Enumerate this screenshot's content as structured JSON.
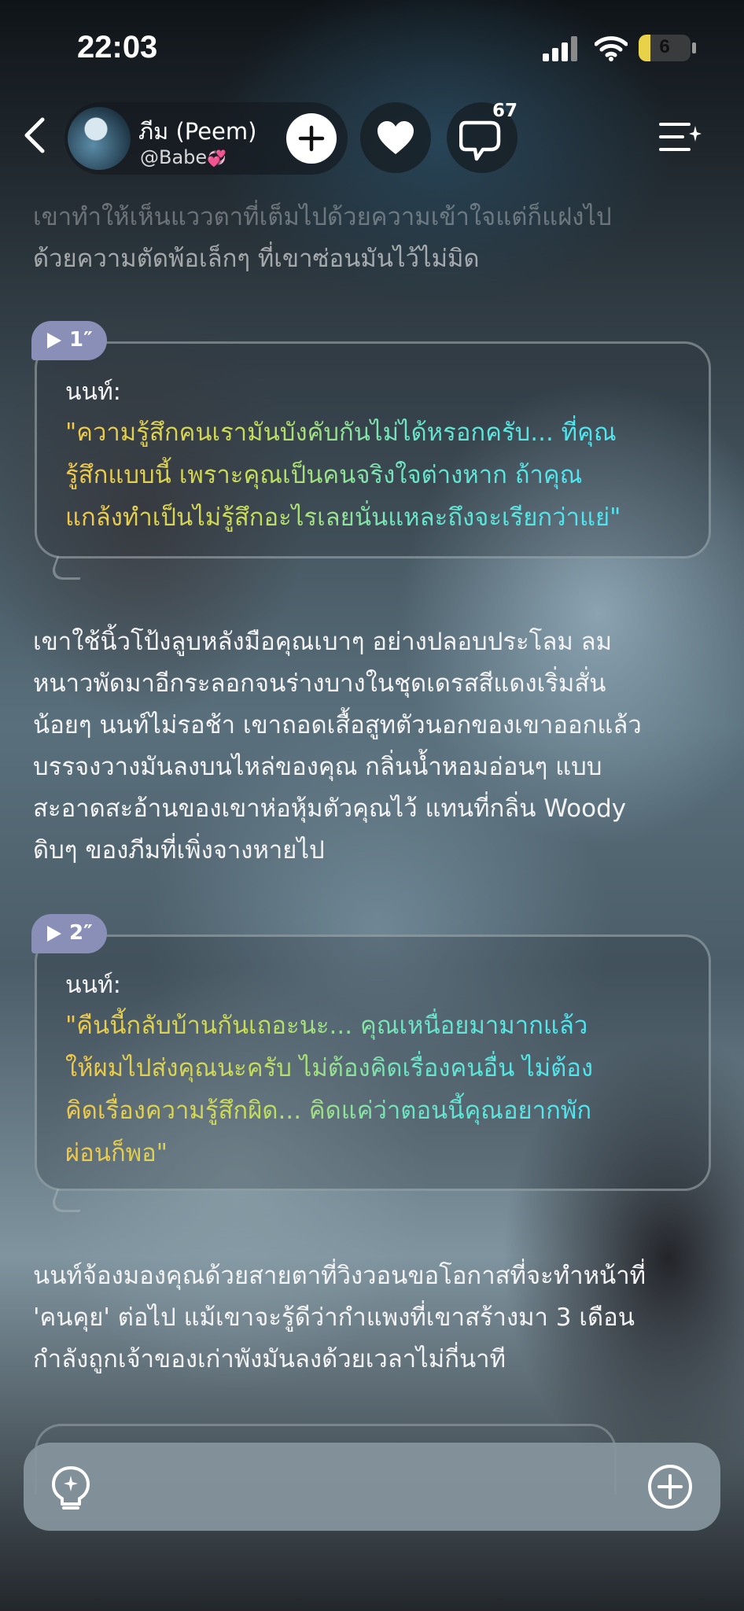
{
  "status_bar": {
    "time": "22:03",
    "battery_level": "6",
    "battery_percent": 6
  },
  "header": {
    "profile_name": "ภีม (Peem)",
    "profile_handle": "@Babe",
    "handle_emoji": "💞",
    "comment_count": "67",
    "icons": [
      "back-arrow-icon",
      "plus-icon",
      "heart-icon",
      "comment-bubble-icon",
      "menu-sparkle-icon"
    ]
  },
  "story": {
    "intro_lines": [
      "เขาทำให้เห็นแววตาที่เต็มไปด้วยความเข้าใจแต่ก็แฝงไป",
      "ด้วยความตัดพ้อเล็กๆ ที่เขาซ่อนมันไว้ไม่มิด"
    ],
    "dialogues": [
      {
        "badge": "1″",
        "speaker": "นนท์:",
        "quote_lines": [
          "\"ความรู้สึกคนเรามันบังคับกันไม่ได้หรอกครับ... ที่คุณ",
          "รู้สึกแบบนี้ เพราะคุณเป็นคนจริงใจต่างหาก ถ้าคุณ",
          "แกล้งทำเป็นไม่รู้สึกอะไรเลยนั่นแหละถึงจะเรียกว่าแย่\""
        ]
      },
      {
        "badge": "2″",
        "speaker": "นนท์:",
        "quote_lines": [
          "\"คืนนี้กลับบ้านกันเถอะนะ... คุณเหนื่อยมามากแล้ว",
          "ให้ผมไปส่งคุณนะครับ ไม่ต้องคิดเรื่องคนอื่น ไม่ต้อง",
          "คิดเรื่องความรู้สึกผิด... คิดแค่ว่าตอนนี้คุณอยากพัก",
          "ผ่อนก็พอ\""
        ]
      }
    ],
    "narration_1_lines": [
      "เขาใช้นิ้วโป้งลูบหลังมือคุณเบาๆ อย่างปลอบประโลม ลม",
      "หนาวพัดมาอีกระลอกจนร่างบางในชุดเดรสสีแดงเริ่มสั่น",
      "น้อยๆ นนท์ไม่รอช้า เขาถอดเสื้อสูทตัวนอกของเขาออกแล้ว",
      "บรรจงวางมันลงบนไหล่ของคุณ กลิ่นน้ำหอมอ่อนๆ แบบ",
      "สะอาดสะอ้านของเขาห่อหุ้มตัวคุณไว้ แทนที่กลิ่น Woody",
      "ดิบๆ ของภีมที่เพิ่งจางหายไป"
    ],
    "narration_2_lines": [
      "นนท์จ้องมองคุณด้วยสายตาที่วิงวอนขอโอกาสที่จะทำหน้าที่",
      "'คนคุย' ต่อไป แม้เขาจะรู้ดีว่ากำแพงที่เขาสร้างมา 3 เดือน",
      "กำลังถูกเจ้าของเก่าพังมันลงด้วยเวลาไม่กี่นาที"
    ]
  },
  "input_bar": {
    "icons": [
      "lightbulb-icon",
      "plus-circle-icon"
    ]
  },
  "colors": {
    "quote_gradient": [
      "#f2c84a",
      "#4fe6f0"
    ],
    "badge": "#8a8fb8",
    "battery": "#e8d24a"
  }
}
